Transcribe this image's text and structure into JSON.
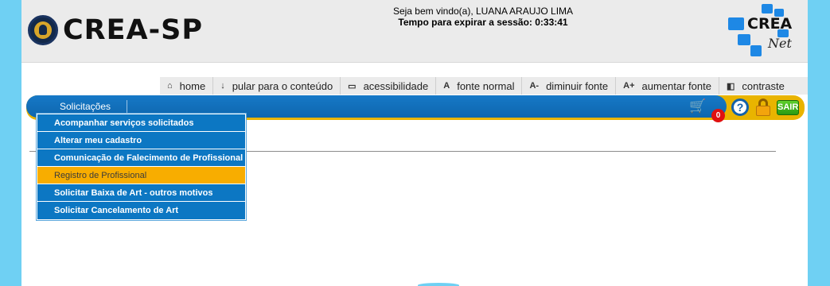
{
  "header": {
    "logo_text": "CREA-SP",
    "welcome": "Seja bem vindo(a), LUANA ARAUJO LIMA",
    "session_timer": "Tempo para expirar a sessão: 0:33:41",
    "net_logo_crea": "CREA",
    "net_logo_net": "Net",
    "logo_squares_color": "#1e88e5"
  },
  "accessibility": {
    "items": [
      {
        "icon": "home-icon",
        "glyph": "⌂",
        "label": "home"
      },
      {
        "icon": "arrow-down-icon",
        "glyph": "↓",
        "label": "pular para o conteúdo"
      },
      {
        "icon": "monitor-icon",
        "glyph": "▭",
        "label": "acessibilidade"
      },
      {
        "icon": "font-icon",
        "glyph": "A",
        "label": "fonte normal"
      },
      {
        "icon": "font-decrease-icon",
        "glyph": "A-",
        "label": "diminuir fonte"
      },
      {
        "icon": "font-increase-icon",
        "glyph": "A+",
        "label": "aumentar fonte"
      },
      {
        "icon": "contrast-icon",
        "glyph": "◧",
        "label": "contraste"
      }
    ]
  },
  "menu": {
    "solicitacoes_label": "Solicitações",
    "cart_count": "0",
    "help_glyph": "?",
    "sair_label": "SAIR",
    "bar_color": "#0e66ae",
    "accent_color": "#e9b400"
  },
  "dropdown": {
    "items": [
      {
        "label": "Acompanhar serviços solicitados",
        "active": false
      },
      {
        "label": "Alterar meu cadastro",
        "active": false
      },
      {
        "label": "Comunicação de Falecimento de Profissional",
        "active": false
      },
      {
        "label": "Registro de Profissional",
        "active": true
      },
      {
        "label": "Solicitar Baixa de Art - outros motivos",
        "active": false
      },
      {
        "label": "Solicitar Cancelamento de Art",
        "active": false
      }
    ],
    "item_color": "#0c77c3",
    "active_color": "#f8ad00"
  }
}
